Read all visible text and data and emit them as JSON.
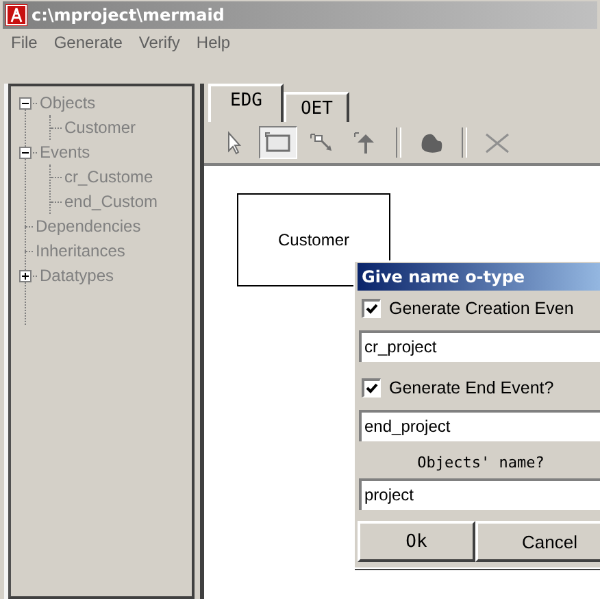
{
  "window": {
    "title": "c:\\mproject\\mermaid"
  },
  "menu": [
    "File",
    "Generate",
    "Verify",
    "Help"
  ],
  "tree": [
    {
      "label": "Objects",
      "expanded": true,
      "children": [
        {
          "label": "Customer"
        }
      ]
    },
    {
      "label": "Events",
      "expanded": true,
      "children": [
        {
          "label": "cr_Custome"
        },
        {
          "label": "end_Custom"
        }
      ]
    },
    {
      "label": "Dependencies"
    },
    {
      "label": "Inheritances"
    },
    {
      "label": "Datatypes",
      "expanded": false
    }
  ],
  "tabs": [
    {
      "label": "EDG",
      "selected": true
    },
    {
      "label": "OET",
      "selected": false
    }
  ],
  "toolbar": [
    {
      "kind": "pointer",
      "selected": false
    },
    {
      "kind": "rectangle",
      "selected": true
    },
    {
      "kind": "link",
      "selected": false
    },
    {
      "kind": "arrow",
      "selected": false
    },
    {
      "kind": "separator"
    },
    {
      "kind": "blob",
      "selected": false
    },
    {
      "kind": "separator"
    },
    {
      "kind": "cross",
      "selected": false
    }
  ],
  "canvas": {
    "nodes": [
      {
        "label": "Customer"
      }
    ]
  },
  "dialog": {
    "title": "Give name o-type",
    "rows": [
      {
        "kind": "checkbox",
        "label": "Generate Creation Even",
        "checked": true
      },
      {
        "kind": "field",
        "value": "cr_project"
      },
      {
        "kind": "checkbox",
        "label": "Generate End Event?",
        "checked": true
      },
      {
        "kind": "field",
        "value": "end_project"
      },
      {
        "kind": "label",
        "label": "Objects' name?"
      },
      {
        "kind": "field",
        "value": "project"
      }
    ],
    "buttons": [
      "Ok",
      "Cancel"
    ]
  }
}
